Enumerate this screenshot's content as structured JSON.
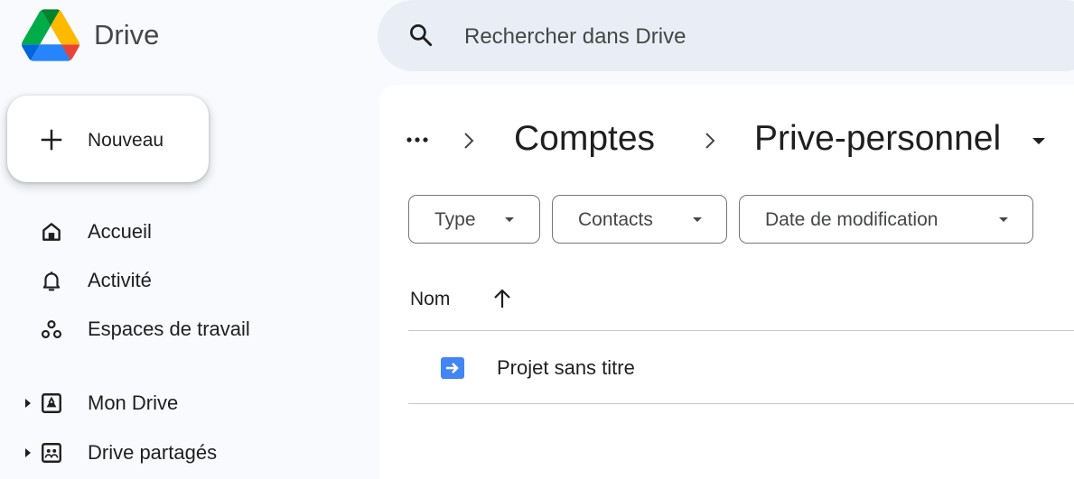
{
  "app": {
    "title": "Drive"
  },
  "search": {
    "placeholder": "Rechercher dans Drive"
  },
  "new_button": {
    "label": "Nouveau"
  },
  "sidebar": {
    "items": [
      {
        "label": "Accueil",
        "icon": "home-icon"
      },
      {
        "label": "Activité",
        "icon": "bell-icon"
      },
      {
        "label": "Espaces de travail",
        "icon": "workspaces-icon"
      },
      {
        "label": "Mon Drive",
        "icon": "my-drive-icon"
      },
      {
        "label": "Drive partagés",
        "icon": "shared-drives-icon"
      }
    ]
  },
  "breadcrumb": {
    "more": "...",
    "items": [
      "Comptes",
      "Prive-personnel"
    ]
  },
  "filters": [
    {
      "label": "Type"
    },
    {
      "label": "Contacts"
    },
    {
      "label": "Date de modification"
    }
  ],
  "table": {
    "columns": {
      "name": "Nom"
    },
    "sort": "ascending",
    "rows": [
      {
        "name": "Projet sans titre",
        "icon": "forms-icon"
      }
    ]
  },
  "colors": {
    "background": "#f8fafd",
    "search_bg": "#e9eef6",
    "file_icon": "#4285f4",
    "logo_green": "#0f9d58",
    "logo_yellow": "#fbbc04",
    "logo_blue": "#4285f4"
  }
}
